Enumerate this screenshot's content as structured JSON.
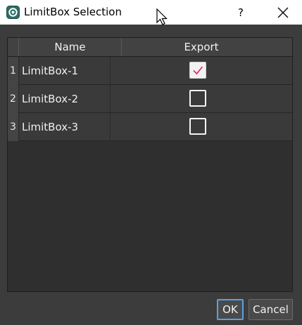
{
  "window": {
    "title": "LimitBox Selection",
    "help_label": "?",
    "accent_color": "#5aa0e8",
    "check_color": "#e0245e"
  },
  "table": {
    "columns": [
      "Name",
      "Export"
    ],
    "rows": [
      {
        "index": "1",
        "name": "LimitBox-1",
        "export": true
      },
      {
        "index": "2",
        "name": "LimitBox-2",
        "export": false
      },
      {
        "index": "3",
        "name": "LimitBox-3",
        "export": false
      }
    ]
  },
  "buttons": {
    "ok_label": "OK",
    "cancel_label": "Cancel"
  }
}
